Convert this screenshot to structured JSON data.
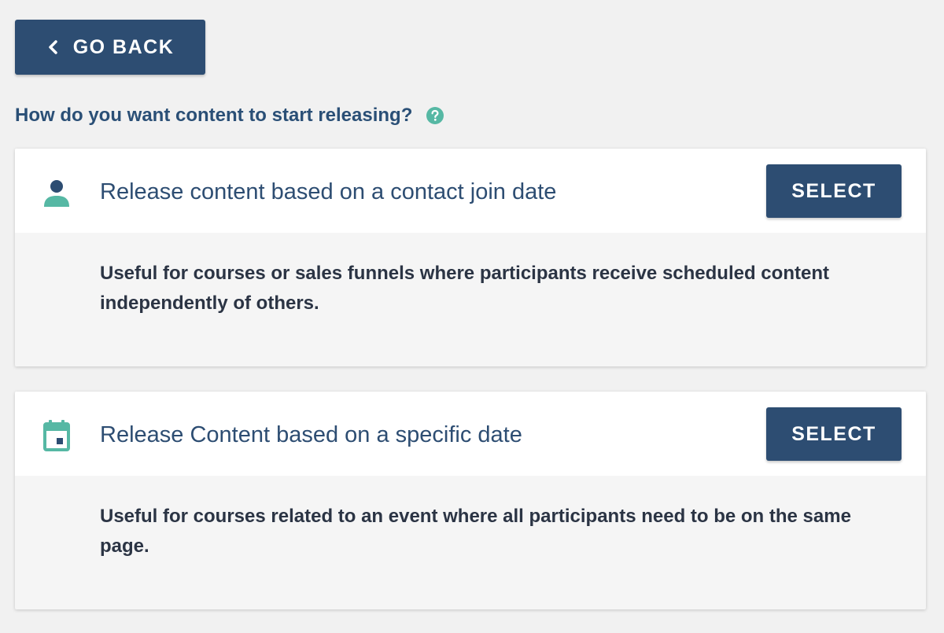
{
  "back_button": {
    "label": "GO BACK",
    "icon": "chevron-left-icon"
  },
  "question": {
    "text": "How do you want content to start releasing?",
    "help_icon": "help-circle-icon"
  },
  "options": [
    {
      "icon": "person-icon",
      "title": "Release content based on a contact join date",
      "button_label": "SELECT",
      "description": "Useful for courses or sales funnels where participants receive scheduled content independently of others."
    },
    {
      "icon": "calendar-icon",
      "title": "Release Content based on a specific date",
      "button_label": "SELECT",
      "description": "Useful for courses related to an event where all participants need to be on the same page."
    }
  ],
  "colors": {
    "primary": "#2d4d72",
    "accent": "#56b8a4",
    "background": "#f1f1f1"
  }
}
